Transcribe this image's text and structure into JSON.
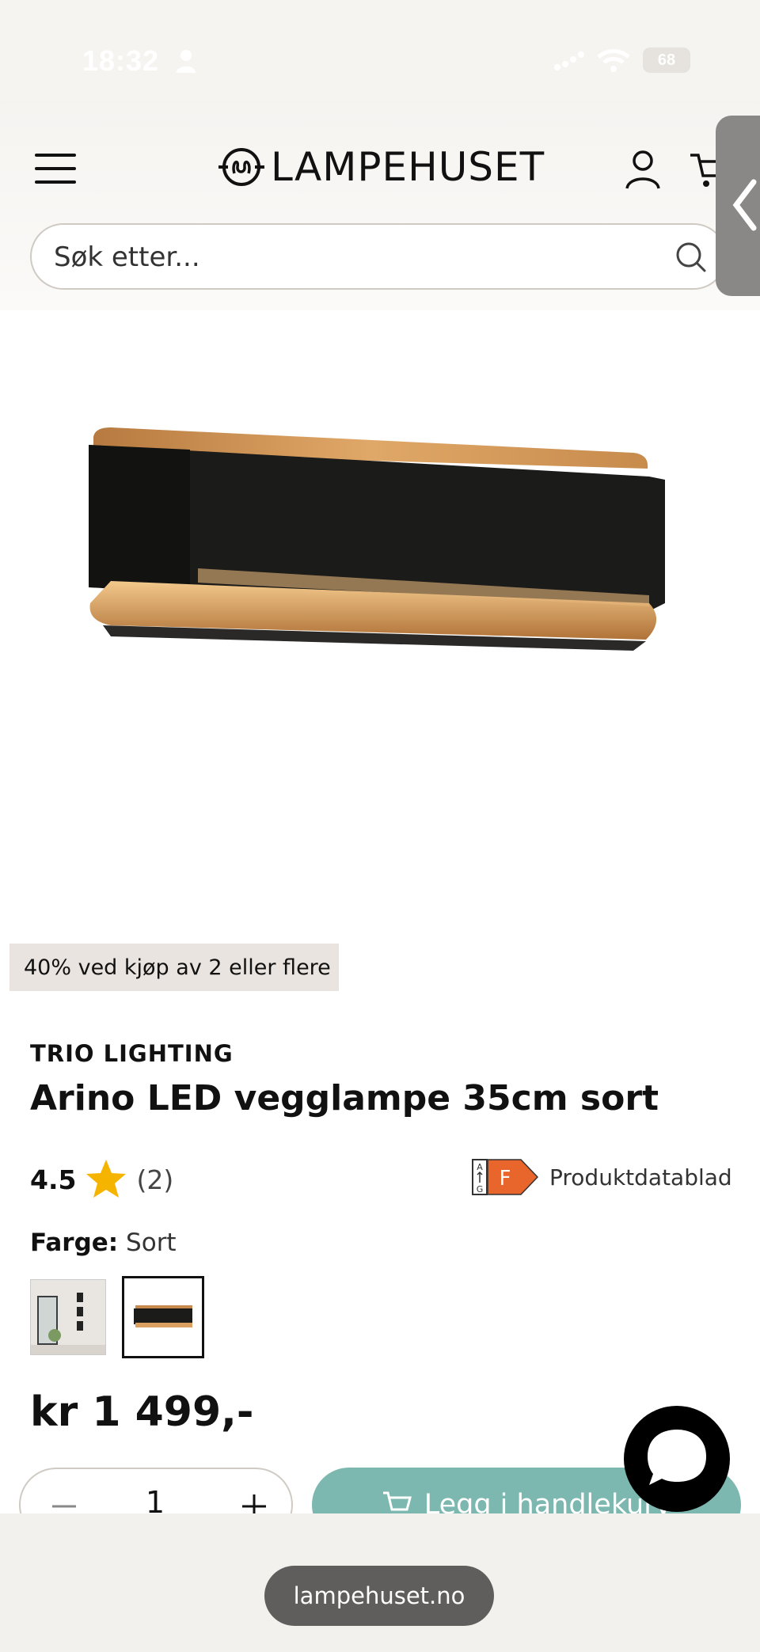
{
  "status_bar": {
    "time": "18:32",
    "battery": "68"
  },
  "header": {
    "logo_text": "LAMPEHUSET",
    "search": {
      "placeholder": "Søk etter...",
      "value": ""
    },
    "icons": [
      "menu-icon",
      "user-icon",
      "cart-icon",
      "chevron-left-icon",
      "search-icon"
    ]
  },
  "product": {
    "promo_badge": "40% ved kjøp av 2 eller flere",
    "brand": "TRIO LIGHTING",
    "title": "Arino LED vegglampe 35cm sort",
    "rating": {
      "value": "4.5",
      "count": "(2)"
    },
    "energy": {
      "class": "F",
      "scale_top": "A",
      "scale_bottom": "G",
      "datasheet_label": "Produktdatablad"
    },
    "color": {
      "label": "Farge:",
      "value": "Sort"
    },
    "price": "kr 1 499,-",
    "quantity": "1",
    "add_to_cart_label": "Legg i handlekurv"
  },
  "colors": {
    "accent_teal": "#7cb8b0",
    "energy_orange": "#e8652c",
    "star_yellow": "#f5b400",
    "badge_bg": "#e9e4df"
  },
  "browser": {
    "url": "lampehuset.no"
  }
}
